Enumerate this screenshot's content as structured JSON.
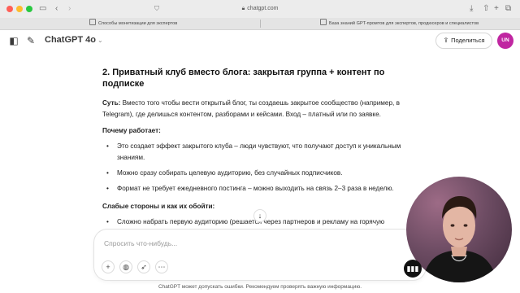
{
  "browser": {
    "url": "chatgpt.com",
    "tabs": [
      {
        "title": "Способы монетизации для экспертов"
      },
      {
        "title": "База знаний GPT-промтов для экспертов, продюсеров и специалистов"
      }
    ]
  },
  "header": {
    "model_name": "ChatGPT 4o",
    "share_label": "Поделиться",
    "avatar_initials": "UN"
  },
  "content": {
    "heading": "2. Приватный клуб вместо блога: закрытая группа + контент по подписке",
    "essence_label": "Суть:",
    "essence_text": " Вместо того чтобы вести открытый блог, ты создаешь закрытое сообщество (например, в Telegram), где делишься контентом, разборами и кейсами. Вход – платный или по заявке.",
    "why_heading": "Почему работает:",
    "why_items": [
      "Это создает эффект закрытого клуба – люди чувствуют, что получают доступ к уникальным знаниям.",
      "Можно сразу собирать целевую аудиторию, без случайных подписчиков.",
      "Формат не требует ежедневного постинга – можно выходить на связь 2–3 раза в неделю."
    ],
    "weak_heading": "Слабые стороны и как их обойти:",
    "weak_items": [
      "Сложно набрать первую аудиторию (решается через партнеров и рекламу на горячую аудиторию)."
    ]
  },
  "composer": {
    "placeholder": "Спросить что-нибудь..."
  },
  "footer": {
    "disclaimer": "ChatGPT может допускать ошибки. Рекомендуем проверять важную информацию."
  },
  "colors": {
    "avatar": "#c026a1",
    "voice_button": "#111111"
  }
}
